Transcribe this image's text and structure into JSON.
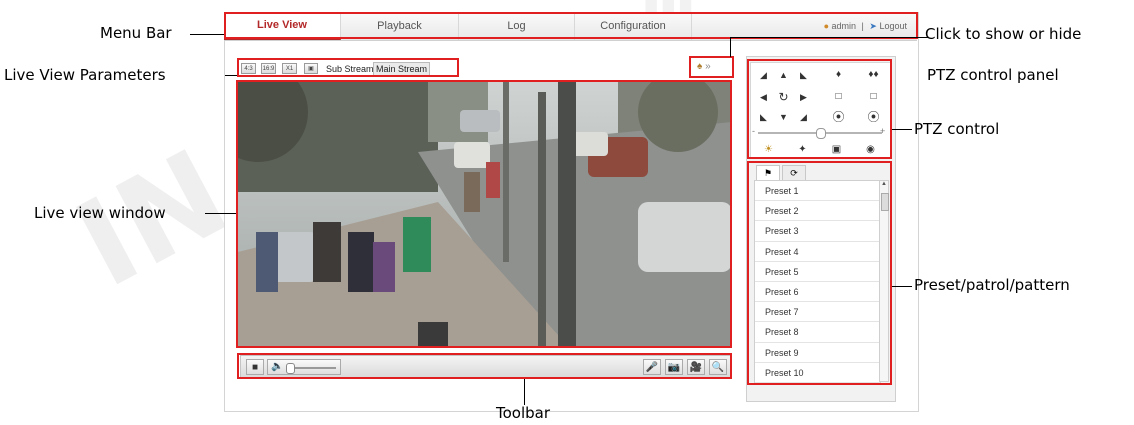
{
  "menu": {
    "tabs": [
      {
        "label": "Live View",
        "active": true
      },
      {
        "label": "Playback",
        "active": false
      },
      {
        "label": "Log",
        "active": false
      },
      {
        "label": "Configuration",
        "active": false
      }
    ],
    "user": "admin",
    "separator": "|",
    "logout": "Logout"
  },
  "params": {
    "sub_stream": "Sub Stream",
    "main_stream": "Main Stream",
    "buttons": [
      "4:3",
      "16:9",
      "X1"
    ]
  },
  "ptz": {
    "toggle": "»"
  },
  "presets": [
    "Preset 1",
    "Preset 2",
    "Preset 3",
    "Preset 4",
    "Preset 5",
    "Preset 6",
    "Preset 7",
    "Preset 8",
    "Preset 9",
    "Preset 10"
  ],
  "annotations": {
    "menu_bar": "Menu Bar",
    "live_view_parameters": "Live View Parameters",
    "live_view_window": "Live view window",
    "click_show_hide": "Click to show or hide",
    "ptz_control_panel": "PTZ control panel",
    "ptz_control": "PTZ control",
    "preset_patrol_pattern": "Preset/patrol/pattern",
    "toolbar": "Toolbar"
  },
  "colors": {
    "accent": "#b32828",
    "annotation_box": "#e02020"
  },
  "icons": [
    "up-left-icon",
    "up-icon",
    "up-right-icon",
    "left-icon",
    "auto-rotate-icon",
    "right-icon",
    "down-left-icon",
    "down-icon",
    "down-right-icon",
    "zoom-in-icon",
    "zoom-out-icon",
    "focus-near-icon",
    "focus-far-icon",
    "iris-open-icon",
    "iris-close-icon",
    "light-icon",
    "wiper-icon",
    "focus-assist-icon",
    "lens-init-icon",
    "preset-tab-icon",
    "patrol-tab-icon",
    "stop-icon",
    "audio-icon",
    "microphone-icon",
    "capture-icon",
    "record-icon",
    "digital-zoom-icon"
  ]
}
